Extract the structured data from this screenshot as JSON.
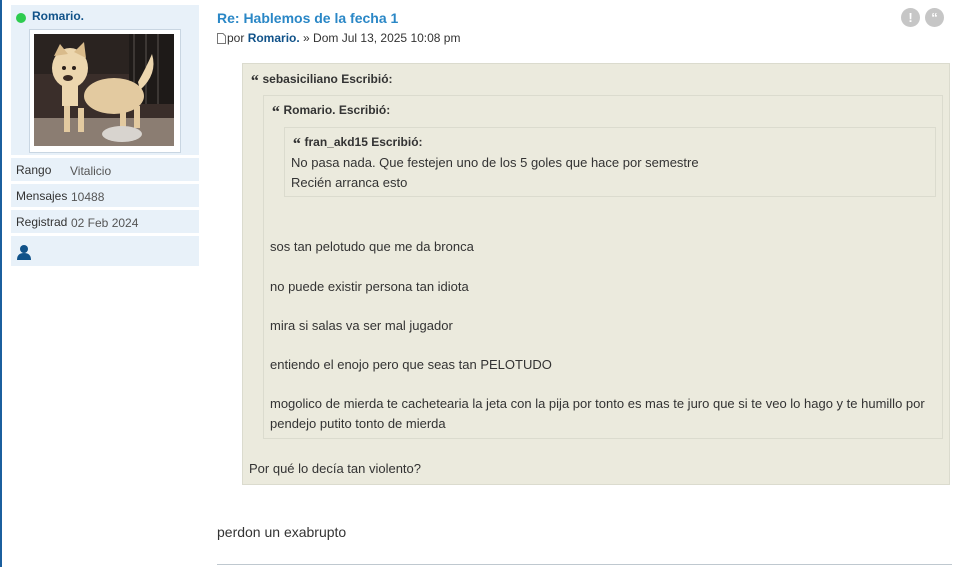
{
  "profile": {
    "username": "Romario.",
    "status_color": "#2ecc4f",
    "avatar_icon": "dog-photo-avatar",
    "rank_label": "Rango",
    "rank_value": "Vitalicio",
    "posts_label": "Mensajes",
    "posts_value": "10488",
    "registered_label": "Registrad",
    "registered_value": "02 Feb 2024",
    "contact_icon": "user-icon"
  },
  "post": {
    "title": "Re: Hablemos de la fecha 1",
    "meta_prefix": "por",
    "author": "Romario.",
    "meta_suffix": "» Dom Jul 13, 2025 10:08 pm",
    "report_icon": "exclamation-icon",
    "quote_icon": "quote-icon",
    "body": "perdon un exabrupto"
  },
  "quote_outer": {
    "cite": "sebasiciliano Escribió:",
    "text": "Por qué lo decía tan violento?"
  },
  "quote_mid": {
    "cite": "Romario. Escribió:",
    "lines": [
      "sos tan pelotudo que me da bronca",
      "no puede existir persona tan idiota",
      "mira si salas va ser mal jugador",
      "entiendo el enojo pero que seas tan PELOTUDO",
      "mogolico de mierda te cachetearia la jeta con la pija por tonto es mas te juro que si te veo lo hago y te humillo por pendejo putito tonto de mierda"
    ]
  },
  "quote_inner": {
    "cite": "fran_akd15 Escribió:",
    "lines": [
      "No pasa nada. Que festejen uno de los 5 goles que hace por semestre",
      "Recién arranca esto"
    ]
  },
  "colors": {
    "accent": "#2a87c6",
    "link": "#105289",
    "quote_bg": "#ebeadd",
    "profile_bg": "#e8f1f9"
  }
}
